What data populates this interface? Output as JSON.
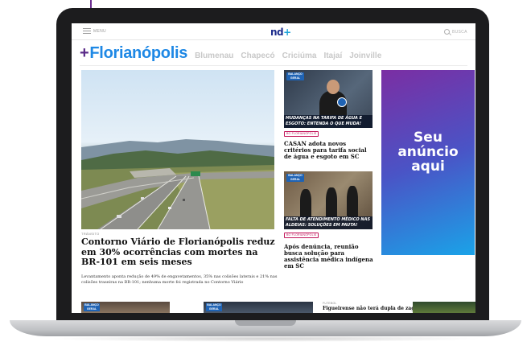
{
  "header": {
    "menu_label": "MENU",
    "logo_text": "nd",
    "logo_plus": "+",
    "search_label": "BUSCA"
  },
  "cities": {
    "plus": "+",
    "active": "Florianópolis",
    "others": [
      "Blumenau",
      "Chapecó",
      "Criciúma",
      "Itajaí",
      "Joinville"
    ]
  },
  "main_story": {
    "kicker": "TRÂNSITO",
    "title": "Contorno Viário de Florianópolis reduz em 30% ocorrências com mortes na BR-101 em seis meses",
    "subtitle": "Levantamento aponta redução de 49% de engavetamentos, 35% nas colisões laterais e 21% nas colisões traseiras na BR-101; nenhuma morte foi registrada no Contorno Viário"
  },
  "side_stories": [
    {
      "badge": "BALANÇO GERAL",
      "caption": "MUDANÇAS NA TARIFA DE ÁGUA E ESGOTO: ENTENDA O QUE MUDA!",
      "tag": "BG FLORIANÓPOLIS",
      "title": "CASAN adota novos critérios para tarifa social de água e esgoto em SC"
    },
    {
      "badge": "BALANÇO GERAL",
      "caption": "FALTA DE ATENDIMENTO MÉDICO NAS ALDEIAS: SOLUÇÕES EM PAUTA!",
      "tag": "BG FLORIANÓPOLIS",
      "title": "Após denúncia, reunião busca solução para assistência médica indígena em SC"
    }
  ],
  "ad": {
    "text": "Seu anúncio aqui"
  },
  "bottom_row": {
    "badge": "BALANÇO GERAL",
    "kicker": "FUTEBOL",
    "title": "Figueirense não terá dupla de zaga"
  },
  "colors": {
    "brand_blue": "#1e88e5",
    "brand_purple": "#5a2a88",
    "badge_blue": "#1f63b4",
    "tag_pink": "#c2185b"
  }
}
